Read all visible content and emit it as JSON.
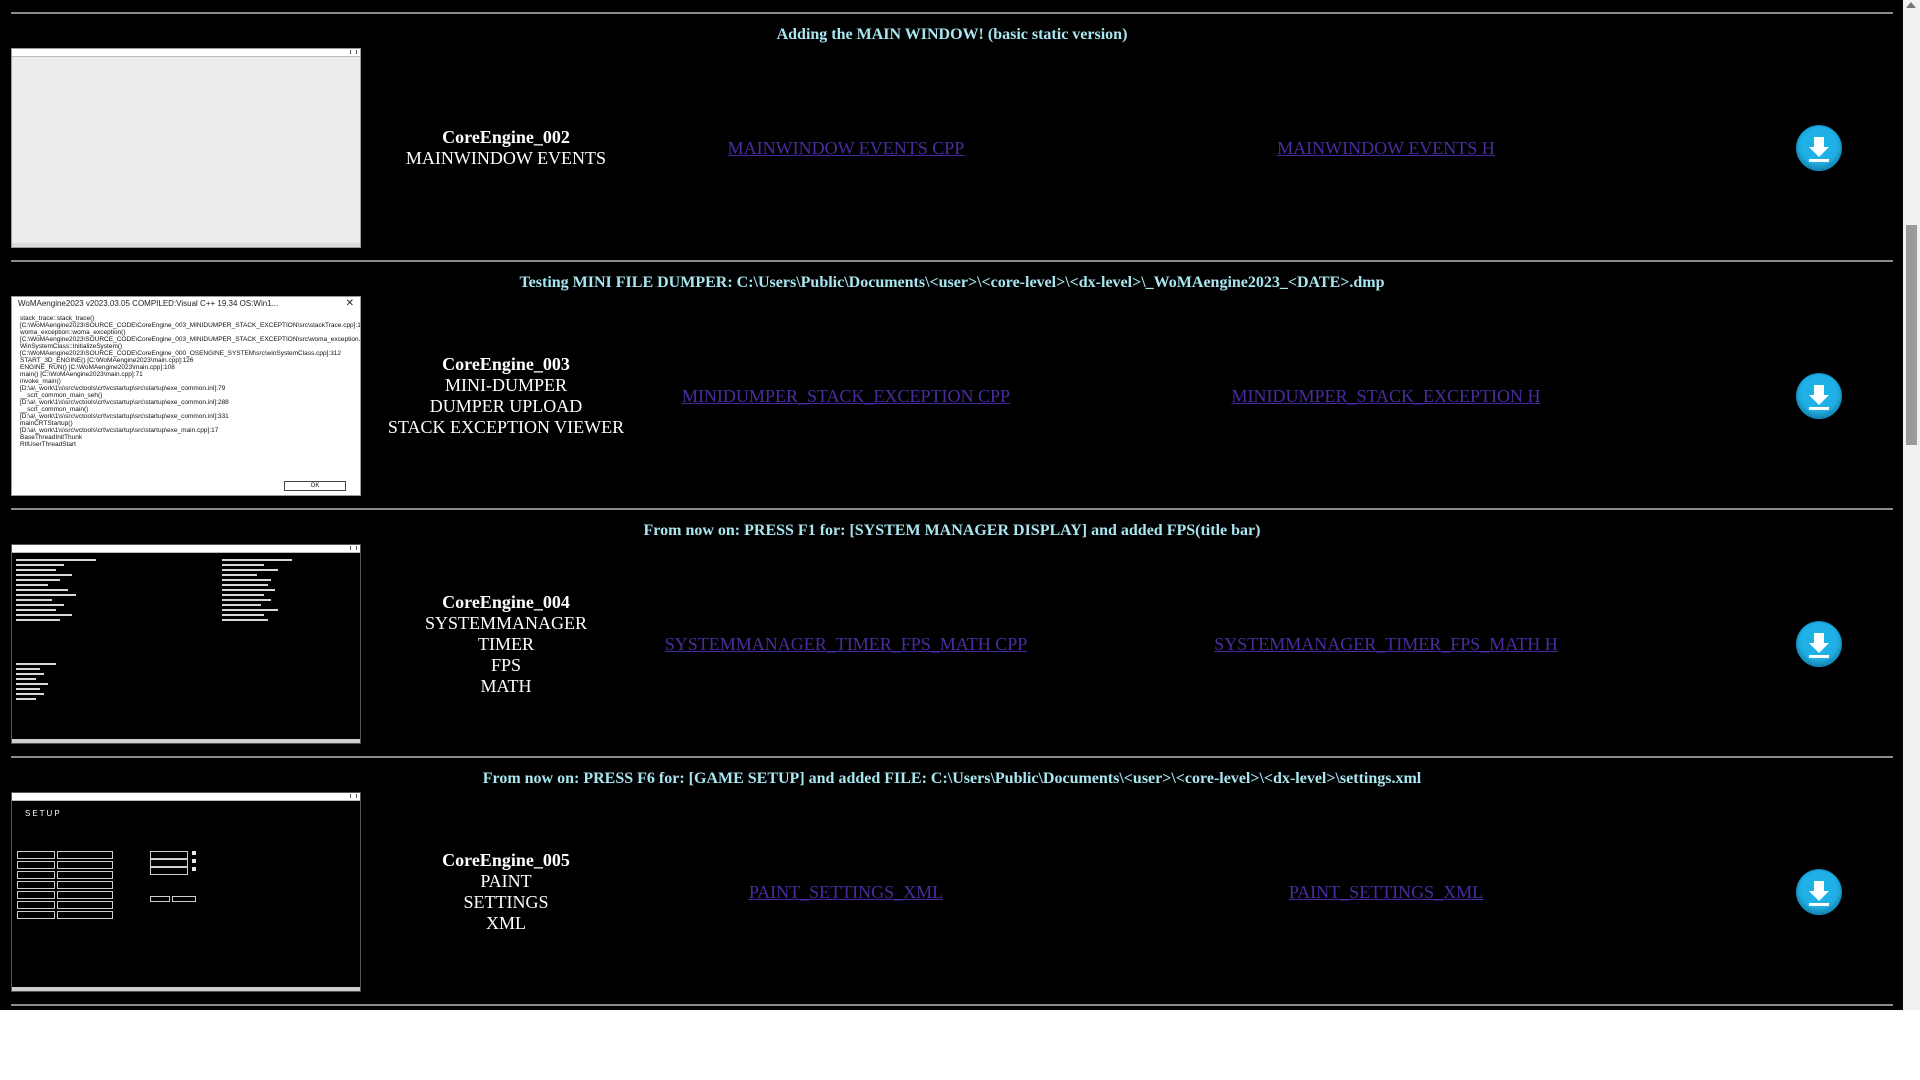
{
  "sections": [
    {
      "title": "Adding the MAIN WINDOW! (basic static version)",
      "engine_name": "CoreEngine_002",
      "engine_lines": [
        "MAINWINDOW EVENTS"
      ],
      "link_cpp": "MAINWINDOW EVENTS CPP",
      "link_h": "MAINWINDOW EVENTS H",
      "download_icon": "download-arrow-icon"
    },
    {
      "title": "Testing MINI FILE DUMPER: C:\\Users\\Public\\Documents\\<user>\\<core-level>\\<dx-level>\\_WoMAengine2023_<DATE>.dmp",
      "engine_name": "CoreEngine_003",
      "engine_lines": [
        "MINI-DUMPER",
        "DUMPER UPLOAD",
        "STACK EXCEPTION VIEWER"
      ],
      "link_cpp": "MINIDUMPER_STACK_EXCEPTION CPP",
      "link_h": "MINIDUMPER_STACK_EXCEPTION H",
      "download_icon": "download-arrow-icon",
      "thumb_title": "WoMAengine2023 v2023.03.05 COMPILED:Visual C++ 19.34 OS:Win1...",
      "thumb_text": [
        "stack_trace::stack_trace()",
        "[C:\\WoMAengine2023\\SOURCE_CODE\\CoreEngine_003_MINIDUMPER_STACK_EXCEPTION\\src\\stackTrace.cpp]:181",
        "woma_exception::woma_exception()",
        "[C:\\WoMAengine2023\\SOURCE_CODE\\CoreEngine_003_MINIDUMPER_STACK_EXCEPTION\\src\\woma_exception.cpp]:39",
        "WinSystemClass::InitializeSystem()",
        "[C:\\WoMAengine2023\\SOURCE_CODE\\CoreEngine_000_OSENGINE_SYSTEM\\src\\winSystemClass.cpp]:312",
        "START_3D_ENGINE() [C:\\WoMAengine2023\\main.cpp]:126",
        "ENGINE_RUN() [C:\\WoMAengine2023\\main.cpp]:108",
        "main() [C:\\WoMAengine2023\\main.cpp]:71",
        "invoke_main()",
        "[D:\\a\\_work\\1\\s\\src\\vctools\\crt\\vcstartup\\src\\startup\\exe_common.inl]:79",
        "__scrt_common_main_seh()",
        "[D:\\a\\_work\\1\\s\\src\\vctools\\crt\\vcstartup\\src\\startup\\exe_common.inl]:288",
        "__scrt_common_main()",
        "[D:\\a\\_work\\1\\s\\src\\vctools\\crt\\vcstartup\\src\\startup\\exe_common.inl]:331",
        "mainCRTStartup()",
        "[D:\\a\\_work\\1\\s\\src\\vctools\\crt\\vcstartup\\src\\startup\\exe_main.cpp]:17",
        "BaseThreadInitThunk",
        "RtlUserThreadStart"
      ],
      "thumb_ok": "OK"
    },
    {
      "title": "From now on: PRESS F1 for: [SYSTEM MANAGER DISPLAY] and added FPS(title bar)",
      "engine_name": "CoreEngine_004",
      "engine_lines": [
        "SYSTEMMANAGER",
        "TIMER",
        "FPS",
        "MATH"
      ],
      "link_cpp": "SYSTEMMANAGER_TIMER_FPS_MATH CPP",
      "link_h": "SYSTEMMANAGER_TIMER_FPS_MATH H",
      "download_icon": "download-arrow-icon"
    },
    {
      "title": "From now on: PRESS F6 for: [GAME SETUP] and added FILE: C:\\Users\\Public\\Documents\\<user>\\<core-level>\\<dx-level>\\settings.xml",
      "engine_name": "CoreEngine_005",
      "engine_lines": [
        "PAINT",
        "SETTINGS",
        "XML"
      ],
      "link_cpp": "PAINT_SETTINGS_XML",
      "link_h": "PAINT_SETTINGS_XML",
      "download_icon": "download-arrow-icon",
      "thumb_setup": "SETUP"
    }
  ]
}
